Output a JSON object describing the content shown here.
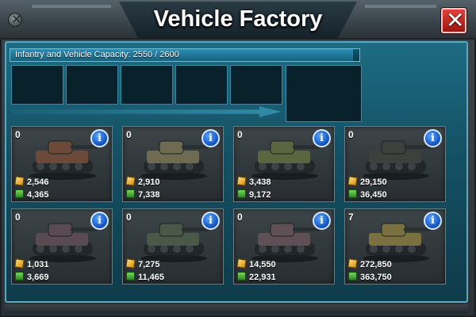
{
  "window": {
    "title": "Vehicle Factory",
    "close_icon": "close-x-icon"
  },
  "capacity": {
    "label": "Infantry and Vehicle Capacity: 2550 / 2600",
    "current": 2550,
    "max": 2600
  },
  "queue": {
    "slots": 6
  },
  "units": [
    {
      "id": "light-tank",
      "count": "0",
      "gold": "2,546",
      "oil": "4,365",
      "color": "#6b4a3a"
    },
    {
      "id": "scout-tank",
      "count": "0",
      "gold": "2,910",
      "oil": "7,338",
      "color": "#6f6a52"
    },
    {
      "id": "rocket-tank",
      "count": "0",
      "gold": "3,438",
      "oil": "9,172",
      "color": "#5b6640"
    },
    {
      "id": "heavy-tank",
      "count": "0",
      "gold": "29,150",
      "oil": "36,450",
      "color": "#3d403c"
    },
    {
      "id": "armored-car",
      "count": "0",
      "gold": "1,031",
      "oil": "3,669",
      "color": "#5a4a52"
    },
    {
      "id": "battle-tank",
      "count": "0",
      "gold": "7,275",
      "oil": "11,465",
      "color": "#4a5848"
    },
    {
      "id": "medium-tank",
      "count": "0",
      "gold": "14,550",
      "oil": "22,931",
      "color": "#5e5054"
    },
    {
      "id": "mech-walker",
      "count": "7",
      "gold": "272,850",
      "oil": "363,750",
      "color": "#7a7040"
    }
  ],
  "icons": {
    "gold": "gold-nugget-icon",
    "oil": "oil-barrel-icon",
    "info": "info-icon"
  },
  "info_glyph": "i"
}
